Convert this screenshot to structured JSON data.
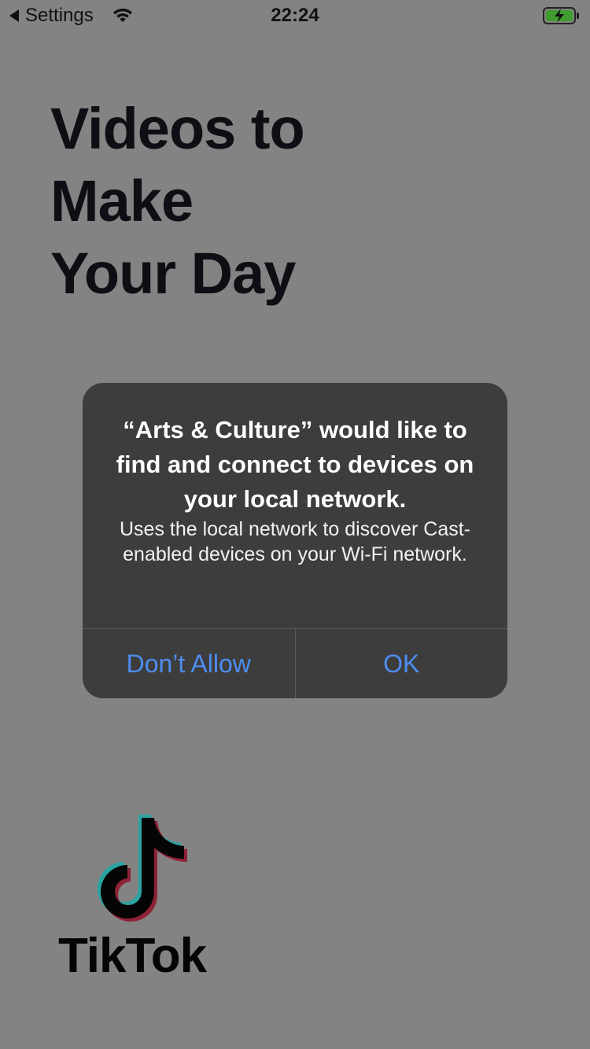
{
  "status_bar": {
    "back_label": "Settings",
    "time": "22:24",
    "icons": [
      "back-triangle-icon",
      "wifi-icon",
      "battery-charging-icon"
    ]
  },
  "headline": {
    "lines": [
      "Videos to",
      "Make",
      "Your Day"
    ]
  },
  "alert": {
    "title": "“Arts & Culture” would like to find and connect to devices on your local network.",
    "message": "Uses the local network to discover Cast-enabled devices on your Wi-Fi network.",
    "buttons": {
      "dont_allow": "Don’t Allow",
      "ok": "OK"
    }
  },
  "logo": {
    "text": "TikTok"
  },
  "colors": {
    "background": "#838383",
    "alert_background": "#3d3d3d",
    "button_blue": "#4d8df0",
    "battery_green": "#3f9c2e"
  }
}
